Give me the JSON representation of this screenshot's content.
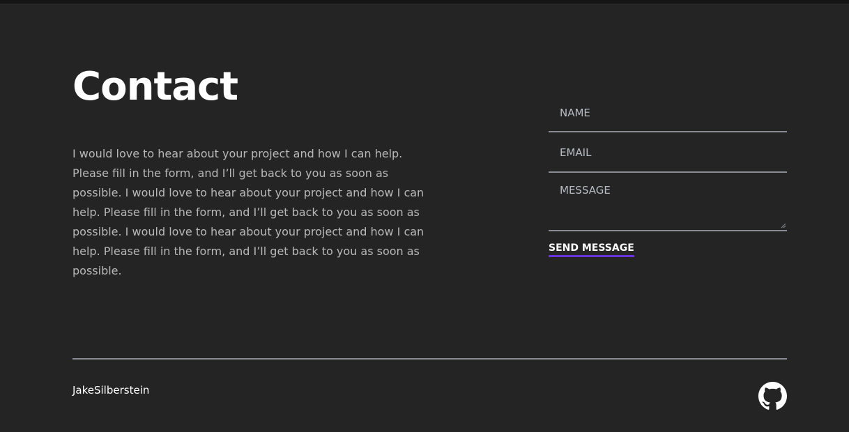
{
  "contact": {
    "title": "Contact",
    "description": "I would love to hear about your project and how I can help. Please fill in the form, and I’ll get back to you as soon as possible. I would love to hear about your project and how I can help. Please fill in the form, and I’ll get back to you as soon as possible. I would love to hear about your project and how I can help. Please fill in the form, and I’ll get back to you as soon as possible."
  },
  "form": {
    "name_placeholder": "NAME",
    "email_placeholder": "EMAIL",
    "message_placeholder": "MESSAGE",
    "submit_label": "SEND MESSAGE"
  },
  "footer": {
    "brand": "JakeSilberstein",
    "social_icon": "github-icon"
  },
  "colors": {
    "background": "#242424",
    "text": "#ffffff",
    "muted_text": "#b8b8b8",
    "divider": "#8a8c94",
    "accent": "#6b32d9"
  }
}
